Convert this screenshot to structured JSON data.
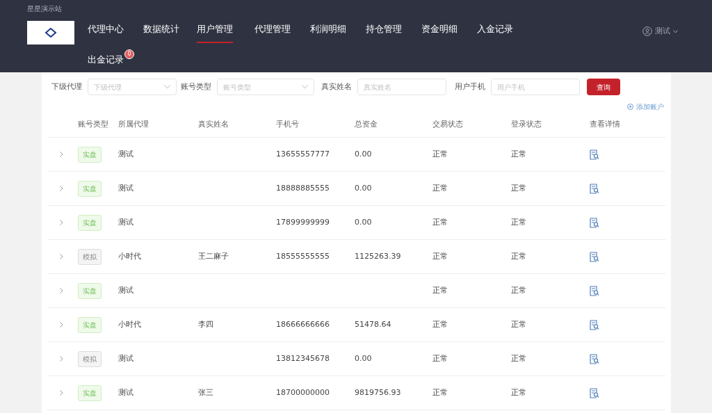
{
  "site_name": "星星演示站",
  "nav": [
    {
      "label": "代理中心",
      "selected": false
    },
    {
      "label": "数据统计",
      "selected": false
    },
    {
      "label": "用户管理",
      "selected": true
    },
    {
      "label": "代理管理",
      "selected": false
    },
    {
      "label": "利润明细",
      "selected": false
    },
    {
      "label": "持仓管理",
      "selected": false
    },
    {
      "label": "资金明细",
      "selected": false
    },
    {
      "label": "入金记录",
      "selected": false
    },
    {
      "label": "出金记录",
      "selected": false,
      "badge": "0"
    }
  ],
  "user": {
    "name": "测试"
  },
  "filters": [
    {
      "label": "下级代理",
      "placeholder": "下级代理",
      "kind": "select"
    },
    {
      "label": "账号类型",
      "placeholder": "账号类型",
      "kind": "select"
    },
    {
      "label": "真实姓名",
      "placeholder": "真实姓名",
      "kind": "input"
    },
    {
      "label": "用户手机",
      "placeholder": "用户手机",
      "kind": "input"
    }
  ],
  "query_button": "查询",
  "add_account": "添加账户",
  "table": {
    "columns": [
      "账号类型",
      "所属代理",
      "真实姓名",
      "手机号",
      "总资金",
      "交易状态",
      "登录状态",
      "查看详情"
    ],
    "rows": [
      {
        "type": {
          "label": "实盘",
          "kind": "real"
        },
        "agent": "测试",
        "name": "",
        "phone": "13655557777",
        "total": "0.00",
        "trade": "正常",
        "login": "正常"
      },
      {
        "type": {
          "label": "实盘",
          "kind": "real"
        },
        "agent": "测试",
        "name": "",
        "phone": "18888885555",
        "total": "0.00",
        "trade": "正常",
        "login": "正常"
      },
      {
        "type": {
          "label": "实盘",
          "kind": "real"
        },
        "agent": "测试",
        "name": "",
        "phone": "17899999999",
        "total": "0.00",
        "trade": "正常",
        "login": "正常"
      },
      {
        "type": {
          "label": "模拟",
          "kind": "demo"
        },
        "agent": "小时代",
        "name": "王二麻子",
        "phone": "18555555555",
        "total": "1125263.39",
        "trade": "正常",
        "login": "正常"
      },
      {
        "type": {
          "label": "实盘",
          "kind": "real"
        },
        "agent": "测试",
        "name": "",
        "phone": "",
        "total": "",
        "trade": "正常",
        "login": "正常"
      },
      {
        "type": {
          "label": "实盘",
          "kind": "real"
        },
        "agent": "小时代",
        "name": "李四",
        "phone": "18666666666",
        "total": "51478.64",
        "trade": "正常",
        "login": "正常"
      },
      {
        "type": {
          "label": "模拟",
          "kind": "demo"
        },
        "agent": "测试",
        "name": "",
        "phone": "13812345678",
        "total": "0.00",
        "trade": "正常",
        "login": "正常"
      },
      {
        "type": {
          "label": "实盘",
          "kind": "real"
        },
        "agent": "测试",
        "name": "张三",
        "phone": "18700000000",
        "total": "9819756.93",
        "trade": "正常",
        "login": "正常"
      }
    ]
  }
}
